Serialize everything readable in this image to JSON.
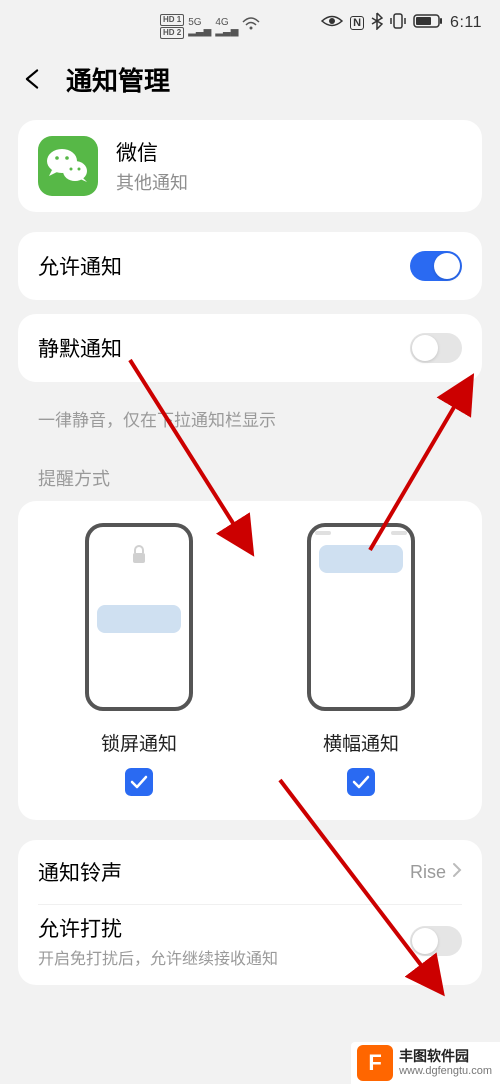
{
  "status": {
    "time": "6:11",
    "hd1": "HD 1",
    "hd2": "HD 2",
    "net1": "5G",
    "net2": "4G"
  },
  "header": {
    "title": "通知管理"
  },
  "app": {
    "name": "微信",
    "sub": "其他通知"
  },
  "allow": {
    "label": "允许通知"
  },
  "silent": {
    "label": "静默通知",
    "desc": "一律静音，仅在下拉通知栏显示"
  },
  "reminder": {
    "section": "提醒方式",
    "lock": "锁屏通知",
    "banner": "横幅通知"
  },
  "ringtone": {
    "label": "通知铃声",
    "value": "Rise"
  },
  "disturb": {
    "label": "允许打扰",
    "sub": "开启免打扰后，允许继续接收通知"
  },
  "watermark": {
    "brand": "丰图软件园",
    "url": "www.dgfengtu.com",
    "letter": "F"
  }
}
